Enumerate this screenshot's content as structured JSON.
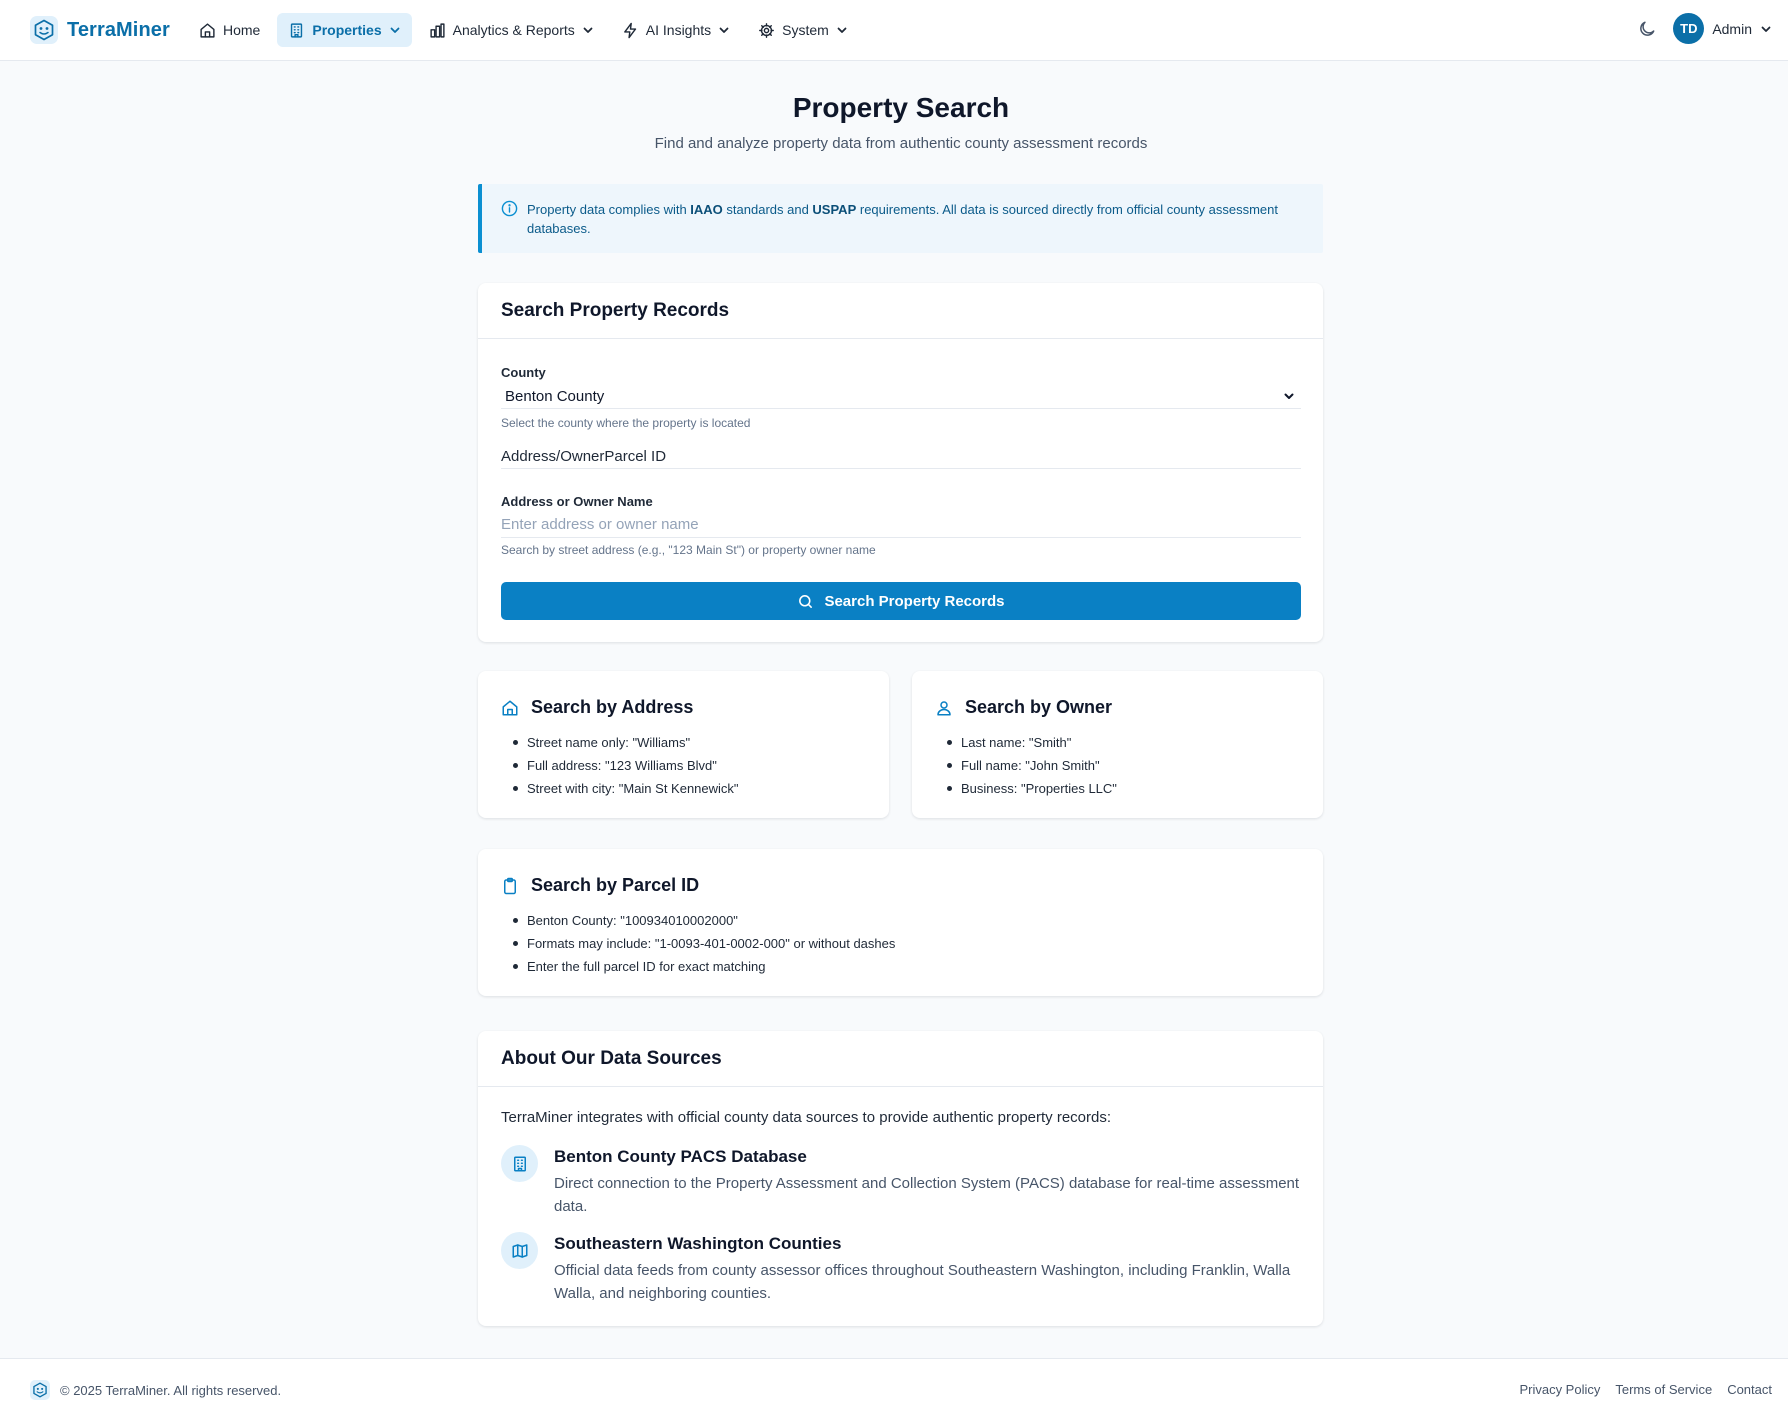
{
  "header": {
    "brand": "TerraMiner",
    "nav": [
      {
        "label": "Home",
        "icon": "home-icon",
        "dropdown": false,
        "active": false
      },
      {
        "label": "Properties",
        "icon": "building-icon",
        "dropdown": true,
        "active": true
      },
      {
        "label": "Analytics & Reports",
        "icon": "bar-chart-icon",
        "dropdown": true,
        "active": false
      },
      {
        "label": "AI Insights",
        "icon": "lightning-icon",
        "dropdown": true,
        "active": false
      },
      {
        "label": "System",
        "icon": "gear-icon",
        "dropdown": true,
        "active": false
      }
    ],
    "theme_toggle_icon": "moon-icon",
    "user": {
      "initials": "TD",
      "name": "Admin"
    }
  },
  "page": {
    "title": "Property Search",
    "subtitle": "Find and analyze property data from authentic county assessment records"
  },
  "alert": {
    "icon": "info-icon",
    "text_before": "Property data complies with ",
    "emphasis_1": "IAAO",
    "text_middle": " standards and ",
    "emphasis_2": "USPAP",
    "text_after": " requirements. All data is sourced directly from official county assessment databases."
  },
  "search_form": {
    "heading": "Search Property Records",
    "county_label": "County",
    "county_value": "Benton County",
    "county_hint": "Select the county where the property is located",
    "tab_1": "Address/Owner",
    "tab_2": "Parcel ID",
    "query_label": "Address or Owner Name",
    "query_placeholder": "Enter address or owner name",
    "query_value": "",
    "query_hint": "Search by street address (e.g., \"123 Main St\") or property owner name",
    "submit_label": "Search Property Records"
  },
  "tips": {
    "address": {
      "title": "Search by Address",
      "icon": "home-icon",
      "items": [
        "Street name only: \"Williams\"",
        "Full address: \"123 Williams Blvd\"",
        "Street with city: \"Main St Kennewick\""
      ]
    },
    "owner": {
      "title": "Search by Owner",
      "icon": "user-icon",
      "items": [
        "Last name: \"Smith\"",
        "Full name: \"John Smith\"",
        "Business: \"Properties LLC\""
      ]
    },
    "parcel": {
      "title": "Search by Parcel ID",
      "icon": "clipboard-icon",
      "items": [
        "Benton County: \"100934010002000\"",
        "Formats may include: \"1-0093-401-0002-000\" or without dashes",
        "Enter the full parcel ID for exact matching"
      ]
    }
  },
  "data_sources": {
    "heading": "About Our Data Sources",
    "intro": "TerraMiner integrates with official county data sources to provide authentic property records:",
    "items": [
      {
        "name": "Benton County PACS Database",
        "icon": "building-icon",
        "description": "Direct connection to the Property Assessment and Collection System (PACS) database for real-time assessment data."
      },
      {
        "name": "Southeastern Washington Counties",
        "icon": "map-icon",
        "description": "Official data feeds from county assessor offices throughout Southeastern Washington, including Franklin, Walla Walla, and neighboring counties."
      }
    ]
  },
  "footer": {
    "copyright": "© 2025 TerraMiner. All rights reserved.",
    "links": [
      "Privacy Policy",
      "Terms of Service",
      "Contact"
    ]
  },
  "colors": {
    "primary": "#0a80c4",
    "brand": "#0b6fa8",
    "alert_bg": "#eef6fc",
    "alert_border": "#0b8fd1",
    "page_bg": "#f8fafc"
  }
}
